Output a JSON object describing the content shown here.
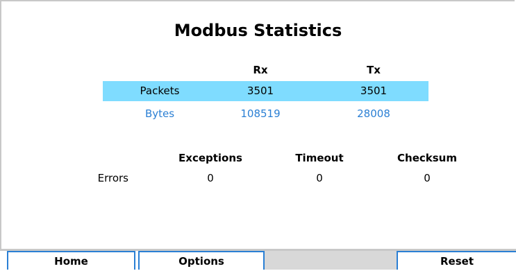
{
  "title": "Modbus Statistics",
  "traffic": {
    "headers": [
      "Rx",
      "Tx"
    ],
    "packets": {
      "label": "Packets",
      "rx": "3501",
      "tx": "3501"
    },
    "bytes": {
      "label": "Bytes",
      "rx": "108519",
      "tx": "28008"
    }
  },
  "errors": {
    "headers": [
      "Exceptions",
      "Timeout",
      "Checksum"
    ],
    "label": "Errors",
    "values": [
      "0",
      "0",
      "0"
    ]
  },
  "footer": {
    "home": "Home",
    "options": "Options",
    "reset": "Reset"
  },
  "colors": {
    "highlight": "#7fdcff",
    "accent": "#2a7fd4"
  }
}
